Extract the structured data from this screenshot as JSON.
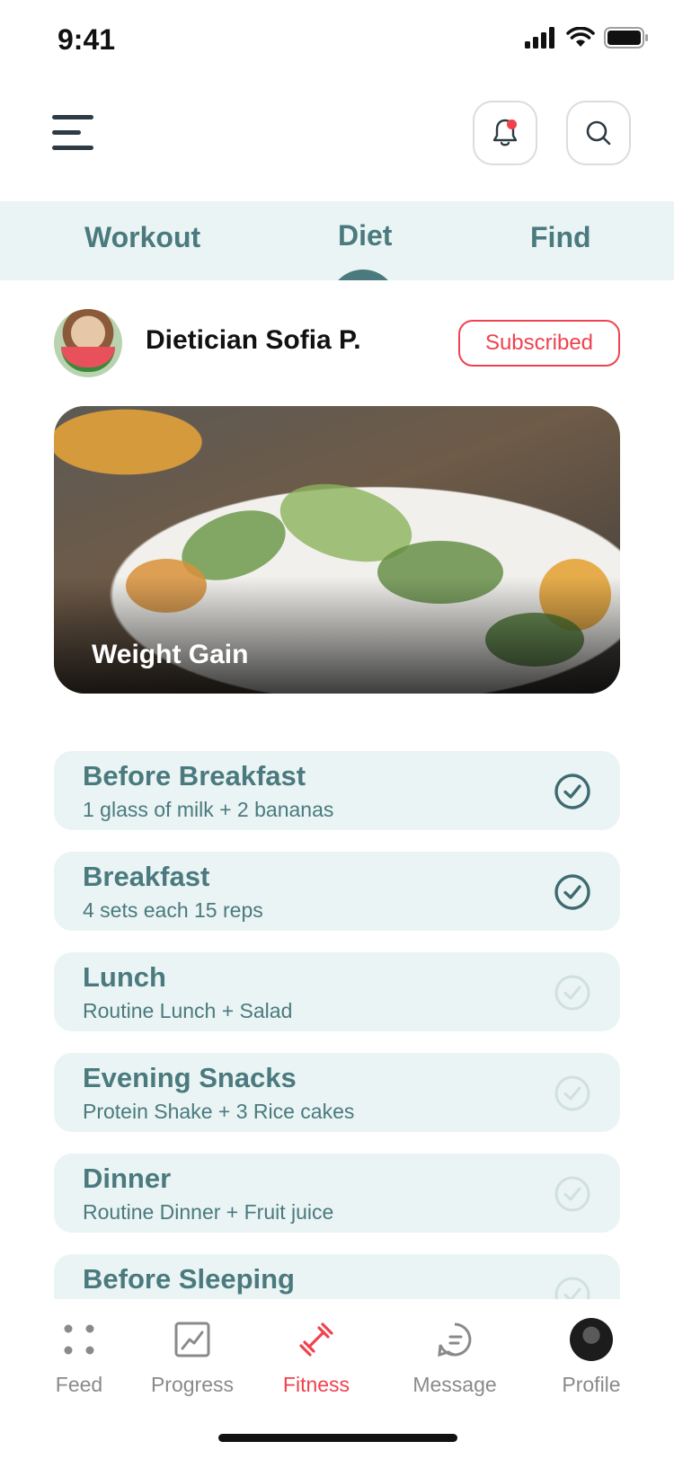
{
  "status_bar": {
    "time": "9:41"
  },
  "header": {
    "menu_icon": "hamburger-menu-icon",
    "notification_icon": "bell-icon",
    "search_icon": "search-icon",
    "notification_dot_color": "#f0424e"
  },
  "tabs": [
    {
      "label": "Workout",
      "active": false
    },
    {
      "label": "Diet",
      "active": true
    },
    {
      "label": "Find",
      "active": false
    }
  ],
  "dietician": {
    "name": "Dietician Sofia P.",
    "subscription_label": "Subscribed"
  },
  "hero": {
    "title": "Weight Gain"
  },
  "meals": [
    {
      "title": "Before Breakfast",
      "description": "1 glass of milk + 2 bananas",
      "checked": true
    },
    {
      "title": "Breakfast",
      "description": "4 sets each 15 reps",
      "checked": true
    },
    {
      "title": "Lunch",
      "description": "Routine Lunch + Salad",
      "checked": false
    },
    {
      "title": "Evening Snacks",
      "description": "Protein Shake + 3 Rice cakes",
      "checked": false
    },
    {
      "title": "Dinner",
      "description": "Routine Dinner + Fruit juice",
      "checked": false
    },
    {
      "title": "Before Sleeping",
      "description": "",
      "checked": false
    }
  ],
  "bottom_nav": [
    {
      "label": "Feed",
      "icon": "feed-dots-icon",
      "active": false
    },
    {
      "label": "Progress",
      "icon": "progress-chart-icon",
      "active": false
    },
    {
      "label": "Fitness",
      "icon": "dumbbell-icon",
      "active": true
    },
    {
      "label": "Message",
      "icon": "message-bubble-icon",
      "active": false
    },
    {
      "label": "Profile",
      "icon": "profile-avatar",
      "active": false
    }
  ],
  "colors": {
    "accent": "#f0424e",
    "teal": "#4a7a7e",
    "card_bg": "#eaf4f4",
    "check_done": "#3e6b70",
    "check_pending": "#cfe0df"
  }
}
